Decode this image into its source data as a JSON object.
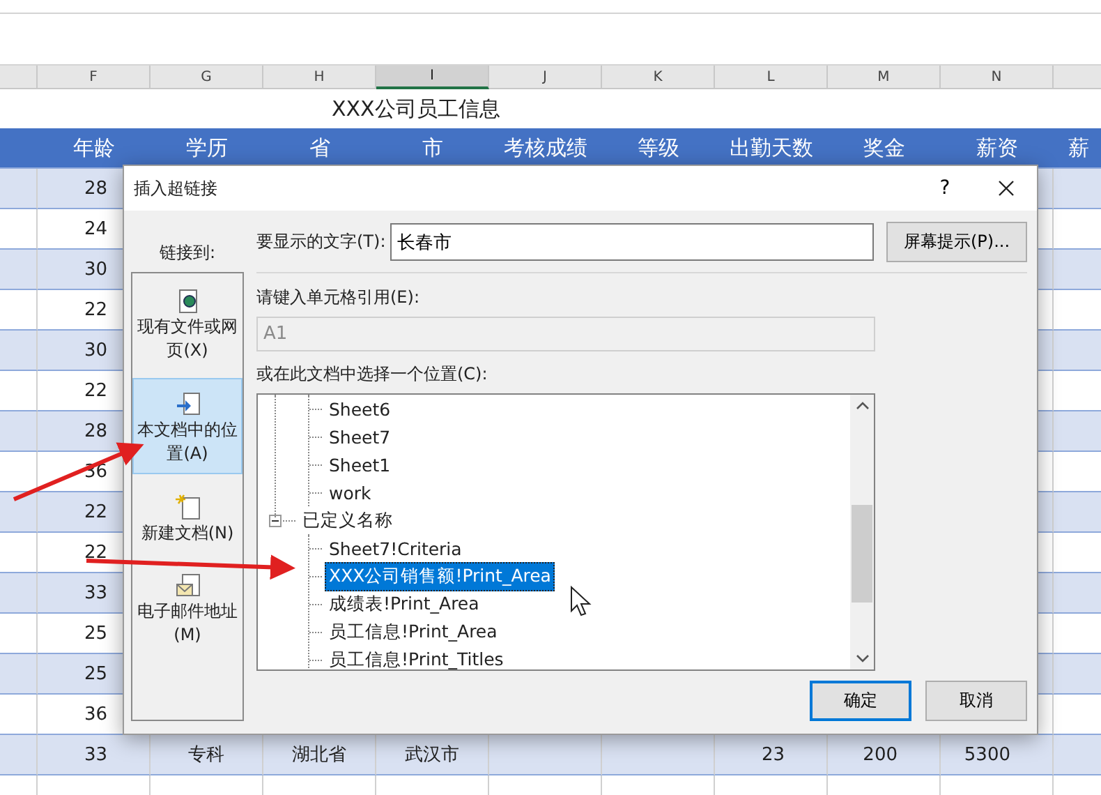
{
  "sheet": {
    "columns": [
      {
        "letter": "F",
        "selected": false
      },
      {
        "letter": "G",
        "selected": false
      },
      {
        "letter": "H",
        "selected": false
      },
      {
        "letter": "I",
        "selected": true
      },
      {
        "letter": "J",
        "selected": false
      },
      {
        "letter": "K",
        "selected": false
      },
      {
        "letter": "L",
        "selected": false
      },
      {
        "letter": "M",
        "selected": false
      },
      {
        "letter": "N",
        "selected": false
      }
    ],
    "title": "XXX公司员工信息",
    "header": [
      "年龄",
      "学历",
      "省",
      "市",
      "考核成绩",
      "等级",
      "出勤天数",
      "奖金",
      "薪资",
      "薪"
    ],
    "rows": [
      {
        "F": "28"
      },
      {
        "F": "24"
      },
      {
        "F": "30"
      },
      {
        "F": "22"
      },
      {
        "F": "30"
      },
      {
        "F": "22"
      },
      {
        "F": "28"
      },
      {
        "F": "36"
      },
      {
        "F": "22"
      },
      {
        "F": "22"
      },
      {
        "F": "33"
      },
      {
        "F": "25"
      },
      {
        "F": "25"
      },
      {
        "F": "36"
      },
      {
        "F": "33",
        "G": "专科",
        "H": "湖北省",
        "I": "武汉市",
        "L": "23",
        "M": "200",
        "N": "5300"
      }
    ]
  },
  "dialog": {
    "title": "插入超链接",
    "help": "?",
    "link_to_label": "链接到:",
    "link_targets": [
      {
        "label": "现有文件或网页(X)",
        "kind": "file",
        "selected": false
      },
      {
        "label": "本文档中的位置(A)",
        "kind": "place",
        "selected": true
      },
      {
        "label": "新建文档(N)",
        "kind": "new",
        "selected": false
      },
      {
        "label": "电子邮件地址(M)",
        "kind": "email",
        "selected": false
      }
    ],
    "display_text": {
      "label": "要显示的文字(T):",
      "value": "长春市"
    },
    "screentip_button": "屏幕提示(P)...",
    "cell_ref": {
      "label": "请键入单元格引用(E):",
      "value": "A1",
      "disabled": true
    },
    "location_label": "或在此文档中选择一个位置(C):",
    "tree": [
      {
        "children": [
          {
            "label": "Sheet6",
            "selected": false
          },
          {
            "label": "Sheet7",
            "selected": false
          },
          {
            "label": "Sheet1",
            "selected": false
          },
          {
            "label": "work",
            "selected": false
          }
        ]
      },
      {
        "label": "已定义名称",
        "expanded": true,
        "selected": false,
        "children": [
          {
            "label": "Sheet7!Criteria",
            "selected": false
          },
          {
            "label": "XXX公司销售额!Print_Area",
            "selected": true
          },
          {
            "label": "成绩表!Print_Area",
            "selected": false
          },
          {
            "label": "员工信息!Print_Area",
            "selected": false
          },
          {
            "label": "员工信息!Print_Titles",
            "selected": false
          }
        ]
      }
    ],
    "buttons": [
      {
        "label": "确定",
        "kind": "default"
      },
      {
        "label": "取消",
        "kind": "normal"
      }
    ]
  }
}
